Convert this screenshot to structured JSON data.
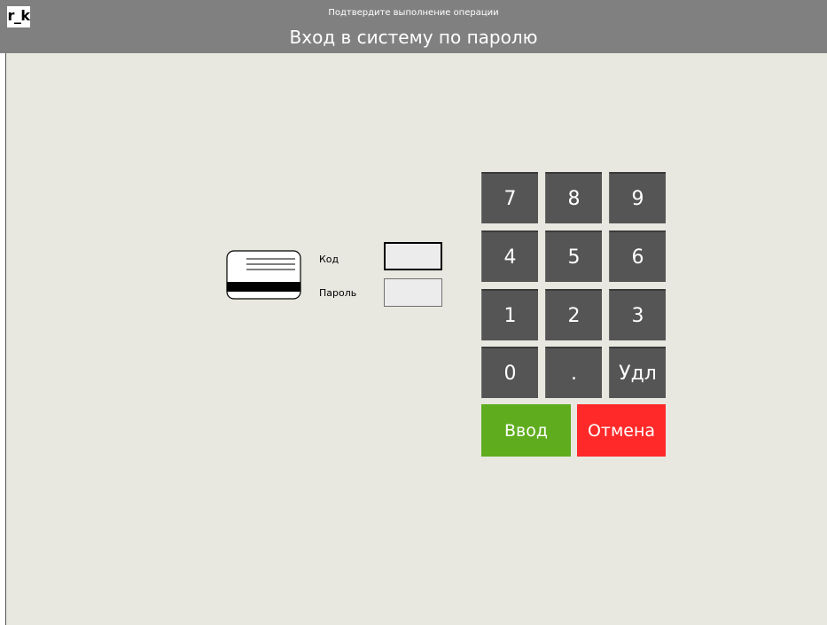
{
  "header": {
    "logo": "r_k",
    "subtitle": "Подтвердите выполнение операции",
    "title": "Вход в систему по паролю"
  },
  "form": {
    "code_label": "Код",
    "code_value": "",
    "password_label": "Пароль",
    "password_value": ""
  },
  "keypad": {
    "keys": [
      "7",
      "8",
      "9",
      "4",
      "5",
      "6",
      "1",
      "2",
      "3",
      "0",
      ".",
      "Удл"
    ],
    "enter_label": "Ввод",
    "cancel_label": "Отмена"
  },
  "colors": {
    "header_bg": "#808080",
    "background": "#e8e8e0",
    "key_bg": "#555555",
    "enter_bg": "#5fad1e",
    "cancel_bg": "#ff2929"
  }
}
